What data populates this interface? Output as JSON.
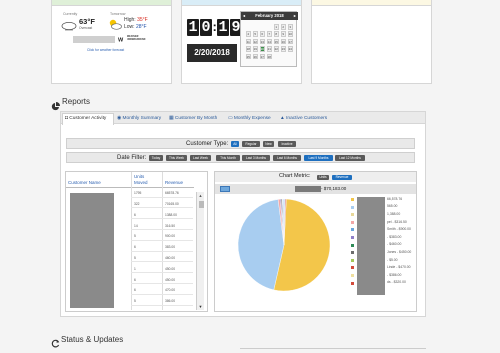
{
  "weather": {
    "today_label": "Currently",
    "today_temp": "63°F",
    "today_cond": "Overcast",
    "tom_label": "Tomorrow",
    "tom_high_label": "High:",
    "tom_high": "35°F",
    "tom_low_label": "Low:",
    "tom_low": "28°F",
    "forecast_link": "Click for weather forecast",
    "brand": "WEATHER UNDERGROUND",
    "colors": {
      "high": "#d7251a",
      "low": "#1e4fa8"
    }
  },
  "clock": {
    "digits": [
      "1",
      "0",
      "1",
      "9"
    ],
    "date": "2/20/2018"
  },
  "calendar": {
    "title": "February 2018",
    "rows": [
      [
        "",
        "",
        "",
        "",
        "1",
        "2",
        "3"
      ],
      [
        "4",
        "5",
        "6",
        "7",
        "8",
        "9",
        "10"
      ],
      [
        "11",
        "12",
        "13",
        "14",
        "15",
        "16",
        "17"
      ],
      [
        "18",
        "19",
        "20",
        "21",
        "22",
        "23",
        "24"
      ],
      [
        "25",
        "26",
        "27",
        "28",
        "",
        "",
        ""
      ]
    ],
    "today": "20"
  },
  "reports": {
    "title": "Reports",
    "tabs": [
      "Customer Activity",
      "Monthly Summary",
      "Customer By Month",
      "Monthly Expense",
      "Inactive Customers"
    ],
    "customer_type_label": "Customer Type:",
    "customer_types": [
      "All",
      "Regular",
      "New",
      "Inactive"
    ],
    "date_filter_label": "Date Filter:",
    "date_filters": [
      "Today",
      "This Week",
      "Last Week",
      "This Month",
      "Last 3 Months",
      "Last 6 Months",
      "Last 9 Months",
      "Last 12 Months"
    ],
    "active_date_filter": "Last 9 Months",
    "table": {
      "headers": [
        "Customer Name",
        "Units Moved",
        "Revenue"
      ],
      "units": [
        "1795",
        "322",
        "6",
        "14",
        "5",
        "6",
        "5",
        "1",
        "6",
        "6",
        "5"
      ],
      "revenue": [
        "66578.76",
        "70165.00",
        "1388.00",
        "316.50",
        "900.00",
        "383.00",
        "460.00",
        "450.00",
        "450.00",
        "470.00",
        "386.00"
      ]
    },
    "chart": {
      "metric_label": "Chart Metric:",
      "metric_options": [
        "Units",
        "Revenue"
      ],
      "total": "- $70,183.00",
      "legend_texts": [
        "66,578.76",
        "565.00",
        "1,388.00",
        "pel - $316.50",
        "Smith - $900.00",
        "- $383.00",
        "- $460.00",
        "Jones - $450.00",
        "- $5.00",
        "Linde - $470.00",
        "- $386.00",
        "ds - $320.00"
      ]
    }
  },
  "status": {
    "title": "Status & Updates"
  },
  "chart_data": {
    "type": "pie",
    "title": "",
    "slices": [
      {
        "label": "slice-1",
        "value": 66578.76,
        "color": "#f3c64a"
      },
      {
        "label": "slice-2",
        "value": 56000,
        "color": "#a8cdf0"
      },
      {
        "label": "slice-3",
        "value": 900,
        "color": "#f3a8a8"
      },
      {
        "label": "slice-4",
        "value": 460,
        "color": "#8f7fc8"
      },
      {
        "label": "slice-5",
        "value": 450,
        "color": "#6d6d6d"
      },
      {
        "label": "slice-6",
        "value": 1388,
        "color": "#d8e6f8"
      },
      {
        "label": "slice-7",
        "value": 386,
        "color": "#d34b3b"
      }
    ],
    "legend_colors": [
      "#f3c64a",
      "#a8cdf0",
      "#e8d89a",
      "#f3a8a8",
      "#6aa6dc",
      "#8f7fc8",
      "#2e8b57",
      "#6d6d6d",
      "#a3c85a",
      "#d34b3b",
      "#f0e0a0",
      "#d34b3b"
    ]
  }
}
